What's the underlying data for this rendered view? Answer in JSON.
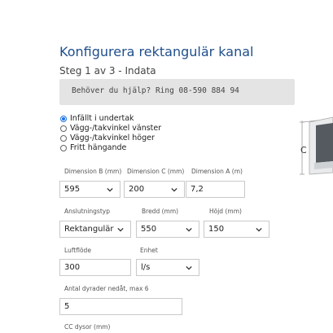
{
  "header": {
    "title": "Konfigurera rektangulär kanal",
    "step": "Steg 1 av 3 - Indata"
  },
  "help": {
    "text": "Behöver du hjälp? Ring 08-590 884 94"
  },
  "mounting": {
    "options": [
      {
        "label": "Infällt i undertak",
        "selected": true
      },
      {
        "label": "Vägg-/takvinkel vänster",
        "selected": false
      },
      {
        "label": "Vägg-/takvinkel höger",
        "selected": false
      },
      {
        "label": "Fritt hängande",
        "selected": false
      }
    ]
  },
  "dimensions": {
    "b_label": "Dimension B (mm)",
    "b_value": "595",
    "c_label": "Dimension C (mm)",
    "c_value": "200",
    "a_label": "Dimension A (m)",
    "a_value": "7,2"
  },
  "connection": {
    "type_label": "Anslutningstyp",
    "type_value": "Rektangulär",
    "width_label": "Bredd (mm)",
    "width_value": "550",
    "height_label": "Höjd (mm)",
    "height_value": "150"
  },
  "flow": {
    "label": "Luftflöde",
    "value": "300",
    "unit_label": "Enhet",
    "unit_value": "l/s"
  },
  "nozzles": {
    "count_label": "Antal dyrader nedåt, max 6",
    "count_value": "5",
    "cc_label": "CC dysor (mm)"
  },
  "diagram": {
    "label": "C"
  },
  "colors": {
    "title": "#1f4e8c",
    "radio_accent": "#1a73e8",
    "help_bg": "#e4e4e4"
  }
}
